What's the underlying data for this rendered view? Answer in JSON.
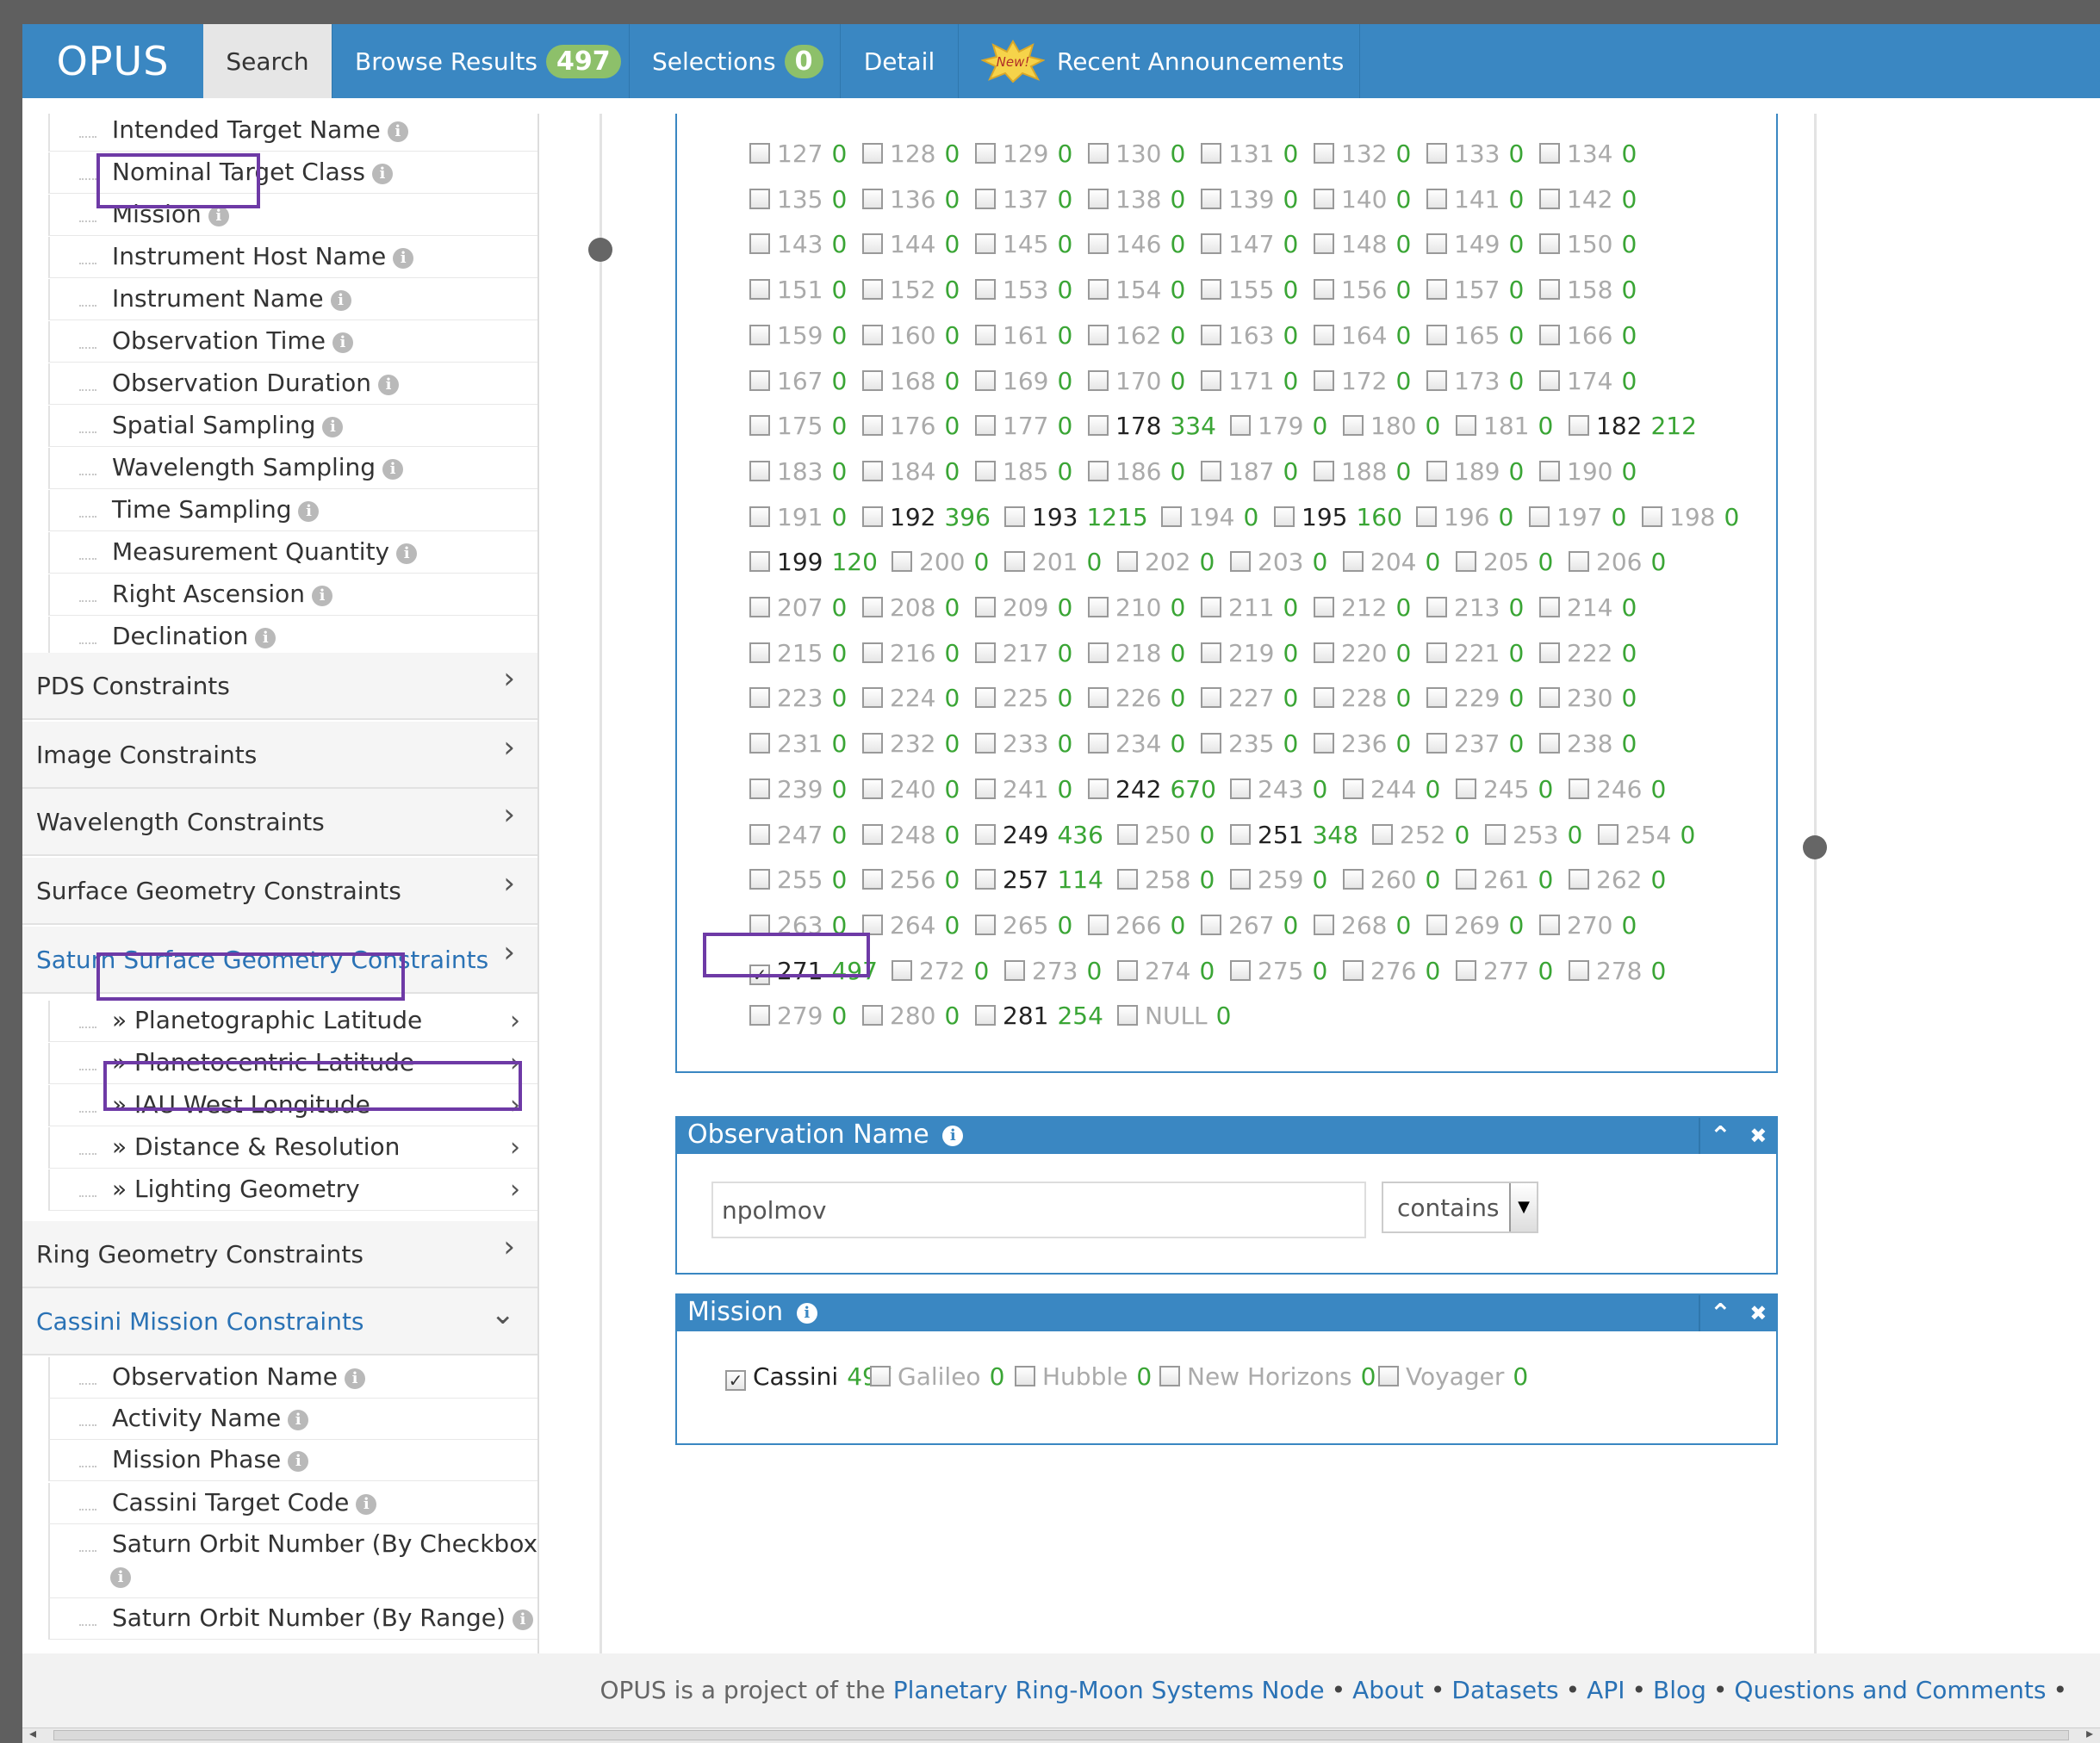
{
  "navbar": {
    "brand": "OPUS",
    "tabs": {
      "search": "Search",
      "browse": "Browse Results",
      "browse_count": "497",
      "selections": "Selections",
      "selections_count": "0",
      "detail": "Detail",
      "new_badge": "New!",
      "announcements": "Recent Announcements"
    }
  },
  "sidebar": {
    "general_items": [
      {
        "label": "Intended Target Name"
      },
      {
        "label": "Nominal Target Class"
      },
      {
        "label": "Mission"
      },
      {
        "label": "Instrument Host Name"
      },
      {
        "label": "Instrument Name"
      },
      {
        "label": "Observation Time"
      },
      {
        "label": "Observation Duration"
      },
      {
        "label": "Spatial Sampling"
      },
      {
        "label": "Wavelength Sampling"
      },
      {
        "label": "Time Sampling"
      },
      {
        "label": "Measurement Quantity"
      },
      {
        "label": "Right Ascension"
      },
      {
        "label": "Declination"
      }
    ],
    "groups": {
      "pds": "PDS Constraints",
      "image": "Image Constraints",
      "wavelength": "Wavelength Constraints",
      "surface": "Surface Geometry Constraints",
      "saturn_surface": "Saturn Surface Geometry Constraints",
      "ring": "Ring Geometry Constraints",
      "cassini": "Cassini Mission Constraints"
    },
    "saturn_items": [
      {
        "label": "» Planetographic Latitude"
      },
      {
        "label": "» Planetocentric Latitude"
      },
      {
        "label": "» IAU West Longitude"
      },
      {
        "label": "» Distance & Resolution"
      },
      {
        "label": "» Lighting Geometry"
      }
    ],
    "cassini_items": [
      {
        "label": "Observation Name"
      },
      {
        "label": "Activity Name"
      },
      {
        "label": "Mission Phase"
      },
      {
        "label": "Cassini Target Code"
      },
      {
        "label": "Saturn Orbit Number (By Checkbox)"
      },
      {
        "label": "Saturn Orbit Number (By Range)"
      }
    ],
    "info_glyph": "i",
    "chevron_right": "›",
    "chevron_down": "⌄"
  },
  "orbit_rows": [
    [
      {
        "l": "127",
        "c": "0"
      },
      {
        "l": "128",
        "c": "0"
      },
      {
        "l": "129",
        "c": "0"
      },
      {
        "l": "130",
        "c": "0"
      },
      {
        "l": "131",
        "c": "0"
      },
      {
        "l": "132",
        "c": "0"
      },
      {
        "l": "133",
        "c": "0"
      },
      {
        "l": "134",
        "c": "0"
      }
    ],
    [
      {
        "l": "135",
        "c": "0"
      },
      {
        "l": "136",
        "c": "0"
      },
      {
        "l": "137",
        "c": "0"
      },
      {
        "l": "138",
        "c": "0"
      },
      {
        "l": "139",
        "c": "0"
      },
      {
        "l": "140",
        "c": "0"
      },
      {
        "l": "141",
        "c": "0"
      },
      {
        "l": "142",
        "c": "0"
      }
    ],
    [
      {
        "l": "143",
        "c": "0"
      },
      {
        "l": "144",
        "c": "0"
      },
      {
        "l": "145",
        "c": "0"
      },
      {
        "l": "146",
        "c": "0"
      },
      {
        "l": "147",
        "c": "0"
      },
      {
        "l": "148",
        "c": "0"
      },
      {
        "l": "149",
        "c": "0"
      },
      {
        "l": "150",
        "c": "0"
      }
    ],
    [
      {
        "l": "151",
        "c": "0"
      },
      {
        "l": "152",
        "c": "0"
      },
      {
        "l": "153",
        "c": "0"
      },
      {
        "l": "154",
        "c": "0"
      },
      {
        "l": "155",
        "c": "0"
      },
      {
        "l": "156",
        "c": "0"
      },
      {
        "l": "157",
        "c": "0"
      },
      {
        "l": "158",
        "c": "0"
      }
    ],
    [
      {
        "l": "159",
        "c": "0"
      },
      {
        "l": "160",
        "c": "0"
      },
      {
        "l": "161",
        "c": "0"
      },
      {
        "l": "162",
        "c": "0"
      },
      {
        "l": "163",
        "c": "0"
      },
      {
        "l": "164",
        "c": "0"
      },
      {
        "l": "165",
        "c": "0"
      },
      {
        "l": "166",
        "c": "0"
      }
    ],
    [
      {
        "l": "167",
        "c": "0"
      },
      {
        "l": "168",
        "c": "0"
      },
      {
        "l": "169",
        "c": "0"
      },
      {
        "l": "170",
        "c": "0"
      },
      {
        "l": "171",
        "c": "0"
      },
      {
        "l": "172",
        "c": "0"
      },
      {
        "l": "173",
        "c": "0"
      },
      {
        "l": "174",
        "c": "0"
      }
    ],
    [
      {
        "l": "175",
        "c": "0"
      },
      {
        "l": "176",
        "c": "0"
      },
      {
        "l": "177",
        "c": "0"
      },
      {
        "l": "178",
        "c": "334"
      },
      {
        "l": "179",
        "c": "0"
      },
      {
        "l": "180",
        "c": "0"
      },
      {
        "l": "181",
        "c": "0"
      },
      {
        "l": "182",
        "c": "212"
      }
    ],
    [
      {
        "l": "183",
        "c": "0"
      },
      {
        "l": "184",
        "c": "0"
      },
      {
        "l": "185",
        "c": "0"
      },
      {
        "l": "186",
        "c": "0"
      },
      {
        "l": "187",
        "c": "0"
      },
      {
        "l": "188",
        "c": "0"
      },
      {
        "l": "189",
        "c": "0"
      },
      {
        "l": "190",
        "c": "0"
      }
    ],
    [
      {
        "l": "191",
        "c": "0"
      },
      {
        "l": "192",
        "c": "396"
      },
      {
        "l": "193",
        "c": "1215"
      },
      {
        "l": "194",
        "c": "0"
      },
      {
        "l": "195",
        "c": "160"
      },
      {
        "l": "196",
        "c": "0"
      },
      {
        "l": "197",
        "c": "0"
      },
      {
        "l": "198",
        "c": "0"
      }
    ],
    [
      {
        "l": "199",
        "c": "120"
      },
      {
        "l": "200",
        "c": "0"
      },
      {
        "l": "201",
        "c": "0"
      },
      {
        "l": "202",
        "c": "0"
      },
      {
        "l": "203",
        "c": "0"
      },
      {
        "l": "204",
        "c": "0"
      },
      {
        "l": "205",
        "c": "0"
      },
      {
        "l": "206",
        "c": "0"
      }
    ],
    [
      {
        "l": "207",
        "c": "0"
      },
      {
        "l": "208",
        "c": "0"
      },
      {
        "l": "209",
        "c": "0"
      },
      {
        "l": "210",
        "c": "0"
      },
      {
        "l": "211",
        "c": "0"
      },
      {
        "l": "212",
        "c": "0"
      },
      {
        "l": "213",
        "c": "0"
      },
      {
        "l": "214",
        "c": "0"
      }
    ],
    [
      {
        "l": "215",
        "c": "0"
      },
      {
        "l": "216",
        "c": "0"
      },
      {
        "l": "217",
        "c": "0"
      },
      {
        "l": "218",
        "c": "0"
      },
      {
        "l": "219",
        "c": "0"
      },
      {
        "l": "220",
        "c": "0"
      },
      {
        "l": "221",
        "c": "0"
      },
      {
        "l": "222",
        "c": "0"
      }
    ],
    [
      {
        "l": "223",
        "c": "0"
      },
      {
        "l": "224",
        "c": "0"
      },
      {
        "l": "225",
        "c": "0"
      },
      {
        "l": "226",
        "c": "0"
      },
      {
        "l": "227",
        "c": "0"
      },
      {
        "l": "228",
        "c": "0"
      },
      {
        "l": "229",
        "c": "0"
      },
      {
        "l": "230",
        "c": "0"
      }
    ],
    [
      {
        "l": "231",
        "c": "0"
      },
      {
        "l": "232",
        "c": "0"
      },
      {
        "l": "233",
        "c": "0"
      },
      {
        "l": "234",
        "c": "0"
      },
      {
        "l": "235",
        "c": "0"
      },
      {
        "l": "236",
        "c": "0"
      },
      {
        "l": "237",
        "c": "0"
      },
      {
        "l": "238",
        "c": "0"
      }
    ],
    [
      {
        "l": "239",
        "c": "0"
      },
      {
        "l": "240",
        "c": "0"
      },
      {
        "l": "241",
        "c": "0"
      },
      {
        "l": "242",
        "c": "670"
      },
      {
        "l": "243",
        "c": "0"
      },
      {
        "l": "244",
        "c": "0"
      },
      {
        "l": "245",
        "c": "0"
      },
      {
        "l": "246",
        "c": "0"
      }
    ],
    [
      {
        "l": "247",
        "c": "0"
      },
      {
        "l": "248",
        "c": "0"
      },
      {
        "l": "249",
        "c": "436"
      },
      {
        "l": "250",
        "c": "0"
      },
      {
        "l": "251",
        "c": "348"
      },
      {
        "l": "252",
        "c": "0"
      },
      {
        "l": "253",
        "c": "0"
      },
      {
        "l": "254",
        "c": "0"
      }
    ],
    [
      {
        "l": "255",
        "c": "0"
      },
      {
        "l": "256",
        "c": "0"
      },
      {
        "l": "257",
        "c": "114"
      },
      {
        "l": "258",
        "c": "0"
      },
      {
        "l": "259",
        "c": "0"
      },
      {
        "l": "260",
        "c": "0"
      },
      {
        "l": "261",
        "c": "0"
      },
      {
        "l": "262",
        "c": "0"
      }
    ],
    [
      {
        "l": "263",
        "c": "0"
      },
      {
        "l": "264",
        "c": "0"
      },
      {
        "l": "265",
        "c": "0"
      },
      {
        "l": "266",
        "c": "0"
      },
      {
        "l": "267",
        "c": "0"
      },
      {
        "l": "268",
        "c": "0"
      },
      {
        "l": "269",
        "c": "0"
      },
      {
        "l": "270",
        "c": "0"
      }
    ],
    [
      {
        "l": "271",
        "c": "497",
        "checked": true
      },
      {
        "l": "272",
        "c": "0"
      },
      {
        "l": "273",
        "c": "0"
      },
      {
        "l": "274",
        "c": "0"
      },
      {
        "l": "275",
        "c": "0"
      },
      {
        "l": "276",
        "c": "0"
      },
      {
        "l": "277",
        "c": "0"
      },
      {
        "l": "278",
        "c": "0"
      }
    ],
    [
      {
        "l": "279",
        "c": "0"
      },
      {
        "l": "280",
        "c": "0"
      },
      {
        "l": "281",
        "c": "254"
      },
      {
        "l": "NULL",
        "c": "0"
      }
    ]
  ],
  "observation_name_widget": {
    "title": "Observation Name",
    "value": "npolmov",
    "operator": "contains"
  },
  "mission_widget": {
    "title": "Mission",
    "options": [
      {
        "l": "Cassini",
        "c": "497",
        "checked": true
      },
      {
        "l": "Galileo",
        "c": "0"
      },
      {
        "l": "Hubble",
        "c": "0"
      },
      {
        "l": "New Horizons",
        "c": "0"
      },
      {
        "l": "Voyager",
        "c": "0"
      }
    ]
  },
  "widget_controls": {
    "collapse": "⌃",
    "close": "✖"
  },
  "checkmark": "✓",
  "footer": {
    "prefix": "OPUS is a project of the",
    "links": [
      "Planetary Ring-Moon Systems Node",
      "About",
      "Datasets",
      "API",
      "Blog",
      "Questions and Comments"
    ],
    "separator": "•"
  },
  "colors": {
    "navbar": "#3a87c2",
    "count_green": "#3aa535",
    "badge_green": "#8dc06a",
    "highlight_purple": "#6e3aa6",
    "link_blue": "#2a72b5"
  }
}
